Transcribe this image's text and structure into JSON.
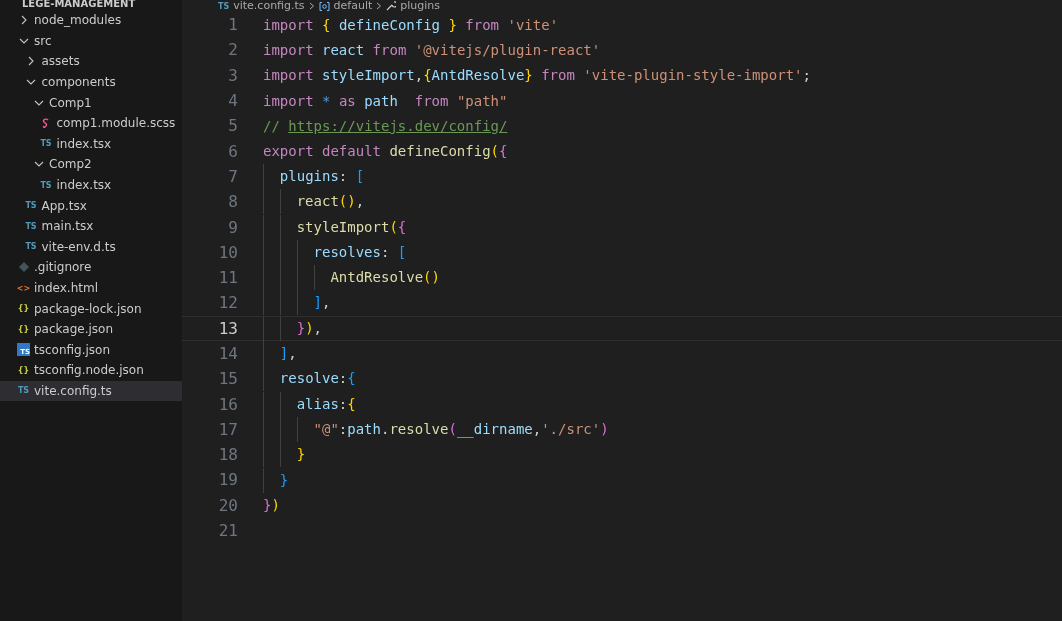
{
  "explorer": {
    "title": "LEGE-MANAGEMENT",
    "tree": [
      {
        "label": "node_modules",
        "kind": "folder",
        "expanded": false,
        "selected": false
      },
      {
        "label": "src",
        "kind": "folder",
        "expanded": true,
        "selected": false,
        "children": [
          {
            "label": "assets",
            "kind": "folder",
            "expanded": false,
            "selected": false
          },
          {
            "label": "components",
            "kind": "folder",
            "expanded": true,
            "selected": false,
            "children": [
              {
                "label": "Comp1",
                "kind": "folder",
                "expanded": true,
                "selected": false,
                "children": [
                  {
                    "label": "comp1.module.scss",
                    "kind": "scss",
                    "selected": false
                  },
                  {
                    "label": "index.tsx",
                    "kind": "ts",
                    "icon_text": "TS",
                    "selected": false
                  }
                ]
              },
              {
                "label": "Comp2",
                "kind": "folder",
                "expanded": true,
                "selected": false,
                "children": [
                  {
                    "label": "index.tsx",
                    "kind": "ts",
                    "icon_text": "TS",
                    "selected": false
                  }
                ]
              }
            ]
          },
          {
            "label": "App.tsx",
            "kind": "ts",
            "icon_text": "TS",
            "selected": false
          },
          {
            "label": "main.tsx",
            "kind": "ts",
            "icon_text": "TS",
            "selected": false
          },
          {
            "label": "vite-env.d.ts",
            "kind": "ts",
            "icon_text": "TS",
            "selected": false
          }
        ]
      },
      {
        "label": ".gitignore",
        "kind": "git",
        "selected": false
      },
      {
        "label": "index.html",
        "kind": "html",
        "icon_text": "<>",
        "selected": false
      },
      {
        "label": "package-lock.json",
        "kind": "json",
        "icon_text": "{}",
        "selected": false
      },
      {
        "label": "package.json",
        "kind": "json",
        "icon_text": "{}",
        "selected": false
      },
      {
        "label": "tsconfig.json",
        "kind": "tsconfig",
        "icon_text": "TS",
        "selected": false
      },
      {
        "label": "tsconfig.node.json",
        "kind": "json",
        "icon_text": "{}",
        "selected": false
      },
      {
        "label": "vite.config.ts",
        "kind": "ts",
        "icon_text": "TS",
        "selected": true
      }
    ]
  },
  "breadcrumb": {
    "icon_text": "TS",
    "file": "vite.config.ts",
    "items": [
      {
        "kind": "symbol",
        "label": "default"
      },
      {
        "kind": "property",
        "label": "plugins"
      }
    ]
  },
  "editor": {
    "lines": [
      {
        "n": "1",
        "current": false,
        "tokens": [
          {
            "kind": "keyword",
            "text": "import "
          },
          {
            "kind": "b1",
            "text": "{"
          },
          {
            "kind": "var",
            "text": " defineConfig "
          },
          {
            "kind": "b1",
            "text": "}"
          },
          {
            "kind": "keyword",
            "text": " from "
          },
          {
            "kind": "string",
            "text": "'vite'"
          }
        ]
      },
      {
        "n": "2",
        "current": false,
        "tokens": [
          {
            "kind": "keyword",
            "text": "import "
          },
          {
            "kind": "var",
            "text": "react "
          },
          {
            "kind": "keyword",
            "text": "from "
          },
          {
            "kind": "string",
            "text": "'@vitejs/plugin-react'"
          }
        ]
      },
      {
        "n": "3",
        "current": false,
        "tokens": [
          {
            "kind": "keyword",
            "text": "import "
          },
          {
            "kind": "var",
            "text": "styleImport"
          },
          {
            "kind": "plain",
            "text": ","
          },
          {
            "kind": "b1",
            "text": "{"
          },
          {
            "kind": "var",
            "text": "AntdResolve"
          },
          {
            "kind": "b1",
            "text": "}"
          },
          {
            "kind": "keyword",
            "text": " from "
          },
          {
            "kind": "string",
            "text": "'vite-plugin-style-import'"
          },
          {
            "kind": "plain",
            "text": ";"
          }
        ]
      },
      {
        "n": "4",
        "current": false,
        "tokens": [
          {
            "kind": "keyword",
            "text": "import "
          },
          {
            "kind": "op",
            "text": "* "
          },
          {
            "kind": "keyword",
            "text": "as "
          },
          {
            "kind": "var",
            "text": "path  "
          },
          {
            "kind": "keyword",
            "text": "from "
          },
          {
            "kind": "string",
            "text": "\"path\""
          }
        ]
      },
      {
        "n": "5",
        "current": false,
        "tokens": [
          {
            "kind": "comment",
            "text": "// "
          },
          {
            "kind": "link",
            "text": "https://vitejs.dev/config/"
          }
        ]
      },
      {
        "n": "6",
        "current": false,
        "tokens": [
          {
            "kind": "keyword",
            "text": "export default "
          },
          {
            "kind": "func",
            "text": "defineConfig"
          },
          {
            "kind": "b1",
            "text": "("
          },
          {
            "kind": "b2",
            "text": "{"
          }
        ]
      },
      {
        "n": "7",
        "current": false,
        "tokens": [
          {
            "kind": "indent"
          },
          {
            "kind": "var",
            "text": "plugins"
          },
          {
            "kind": "plain",
            "text": ": "
          },
          {
            "kind": "b3",
            "text": "["
          }
        ]
      },
      {
        "n": "8",
        "current": false,
        "tokens": [
          {
            "kind": "indent"
          },
          {
            "kind": "indent"
          },
          {
            "kind": "func",
            "text": "react"
          },
          {
            "kind": "b1",
            "text": "()"
          },
          {
            "kind": "plain",
            "text": ","
          }
        ]
      },
      {
        "n": "9",
        "current": false,
        "tokens": [
          {
            "kind": "indent"
          },
          {
            "kind": "indent"
          },
          {
            "kind": "func",
            "text": "styleImport"
          },
          {
            "kind": "b1",
            "text": "("
          },
          {
            "kind": "b2",
            "text": "{"
          }
        ]
      },
      {
        "n": "10",
        "current": false,
        "tokens": [
          {
            "kind": "indent"
          },
          {
            "kind": "indent"
          },
          {
            "kind": "indent"
          },
          {
            "kind": "var",
            "text": "resolves"
          },
          {
            "kind": "plain",
            "text": ": "
          },
          {
            "kind": "b3",
            "text": "["
          }
        ]
      },
      {
        "n": "11",
        "current": false,
        "tokens": [
          {
            "kind": "indent"
          },
          {
            "kind": "indent"
          },
          {
            "kind": "indent"
          },
          {
            "kind": "indent"
          },
          {
            "kind": "func",
            "text": "AntdResolve"
          },
          {
            "kind": "b1",
            "text": "()"
          }
        ]
      },
      {
        "n": "12",
        "current": false,
        "tokens": [
          {
            "kind": "indent"
          },
          {
            "kind": "indent"
          },
          {
            "kind": "indent"
          },
          {
            "kind": "b3",
            "text": "]"
          },
          {
            "kind": "plain",
            "text": ","
          }
        ]
      },
      {
        "n": "13",
        "current": true,
        "tokens": [
          {
            "kind": "indent"
          },
          {
            "kind": "indent"
          },
          {
            "kind": "b2",
            "text": "}"
          },
          {
            "kind": "b1",
            "text": ")"
          },
          {
            "kind": "plain",
            "text": ","
          }
        ]
      },
      {
        "n": "14",
        "current": false,
        "tokens": [
          {
            "kind": "indent"
          },
          {
            "kind": "b3",
            "text": "]"
          },
          {
            "kind": "plain",
            "text": ","
          }
        ]
      },
      {
        "n": "15",
        "current": false,
        "tokens": [
          {
            "kind": "indent"
          },
          {
            "kind": "var",
            "text": "resolve"
          },
          {
            "kind": "plain",
            "text": ":"
          },
          {
            "kind": "b3",
            "text": "{"
          }
        ]
      },
      {
        "n": "16",
        "current": false,
        "tokens": [
          {
            "kind": "indent"
          },
          {
            "kind": "indent"
          },
          {
            "kind": "var",
            "text": "alias"
          },
          {
            "kind": "plain",
            "text": ":"
          },
          {
            "kind": "b1",
            "text": "{"
          }
        ]
      },
      {
        "n": "17",
        "current": false,
        "tokens": [
          {
            "kind": "indent"
          },
          {
            "kind": "indent"
          },
          {
            "kind": "indent"
          },
          {
            "kind": "string",
            "text": "\"@\""
          },
          {
            "kind": "plain",
            "text": ":"
          },
          {
            "kind": "var",
            "text": "path"
          },
          {
            "kind": "plain",
            "text": "."
          },
          {
            "kind": "func",
            "text": "resolve"
          },
          {
            "kind": "b2",
            "text": "("
          },
          {
            "kind": "var",
            "text": "__dirname"
          },
          {
            "kind": "plain",
            "text": ","
          },
          {
            "kind": "string",
            "text": "'./src'"
          },
          {
            "kind": "b2",
            "text": ")"
          }
        ]
      },
      {
        "n": "18",
        "current": false,
        "tokens": [
          {
            "kind": "indent"
          },
          {
            "kind": "indent"
          },
          {
            "kind": "b1",
            "text": "}"
          }
        ]
      },
      {
        "n": "19",
        "current": false,
        "tokens": [
          {
            "kind": "indent"
          },
          {
            "kind": "b3",
            "text": "}"
          }
        ]
      },
      {
        "n": "20",
        "current": false,
        "tokens": [
          {
            "kind": "b2",
            "text": "}"
          },
          {
            "kind": "b1",
            "text": ")"
          }
        ]
      },
      {
        "n": "21",
        "current": false
      }
    ]
  }
}
